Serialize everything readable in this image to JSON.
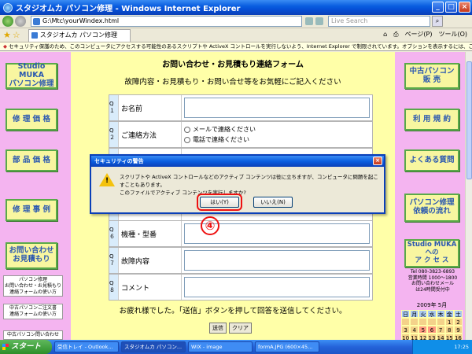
{
  "window": {
    "title": "スタジオムカ パソコン修理 - Windows Internet Explorer",
    "min": "_",
    "max": "□",
    "close": "×"
  },
  "address": {
    "url": "G:\\Mtc\\yourWindex.html",
    "search_placeholder": "Live Search"
  },
  "tabs": {
    "active_tab": "スタジオムカ パソコン修理",
    "home": "⌂",
    "print": "⎙",
    "page_menu": "ページ(P)",
    "tools_menu": "ツール(O)"
  },
  "infobar": {
    "text": "セキュリティ保護のため、このコンピュータにアクセスする可能性のあるスクリプトや ActiveX コントロールを実行しないよう、Internet Explorer で制限されています。オプションを表示するには、ここをクリックしてください..."
  },
  "left_nav": {
    "items": [
      "Studio MUKA\nパソコン修理",
      "修 理 価 格",
      "部 品 価 格",
      "修 理 事 例",
      "お問い合わせ\nお見積もり"
    ],
    "note1": "パソコン修理\nお問い合わせ・お見積もり\n連絡フォームの使い方",
    "note2": "中古パソコンご注文書\n連絡フォームの使い方",
    "note3": "中古パソコン問い合わせ"
  },
  "right_nav": {
    "items": [
      "中古パソコン\n販  売",
      "利 用 規 約",
      "よくある質問",
      "パソコン修理\n依頼の流れ",
      "Studio MUKA\nへの\nア ク セ ス"
    ],
    "contact": "Tel 080-3823-6893\n営業時間 1000〜1800\nお問い合わせメール\nは24時間受付中",
    "calendar_title": "2009年 5月",
    "calendar_head": [
      "日",
      "月",
      "火",
      "水",
      "木",
      "金",
      "土"
    ],
    "calendar_days": [
      "",
      "",
      "",
      "",
      "",
      "1",
      "2",
      "3",
      "4",
      "5",
      "6",
      "7",
      "8",
      "9",
      "10",
      "11",
      "12",
      "13",
      "14",
      "15",
      "16"
    ]
  },
  "form": {
    "title": "お問い合わせ・お見積もり連絡フォーム",
    "subtitle": "故障内容・お見積もり・お問い合せ等をお気軽にご記入ください",
    "rows": [
      {
        "num": "Q１",
        "label": "お名前"
      },
      {
        "num": "Q２",
        "label": "ご連絡方法",
        "options": [
          "メールで連絡ください",
          "電話で連絡ください"
        ]
      },
      {
        "num": "Q６",
        "label": "機種・型番"
      },
      {
        "num": "Q７",
        "label": "故障内容"
      },
      {
        "num": "Q８",
        "label": "コメント"
      }
    ],
    "closing": "お疲れ様でした。「送信」ボタンを押して回答を送信してください。",
    "send_label": "送信",
    "clear_label": "クリア"
  },
  "dialog": {
    "title": "セキュリティの警告",
    "message1": "スクリプトや ActiveX コントロールなどのアクティブ コンテンツは役に立ちますが、コンピュータに問題を起こすこともあります。",
    "message2": "このファイルでアクティブ コンテンツを実行しますか?",
    "yes_label": "はい(Y)",
    "no_label": "いいえ(N)",
    "close": "×"
  },
  "annotation": {
    "step": "④"
  },
  "taskbar": {
    "start_label": "スタート",
    "tasks": [
      "受信トレイ - Outlook...",
      "スタジオムカ パソコン...",
      "WIX - image",
      "formA.JPG (600×45..."
    ],
    "clock": "17:25"
  }
}
